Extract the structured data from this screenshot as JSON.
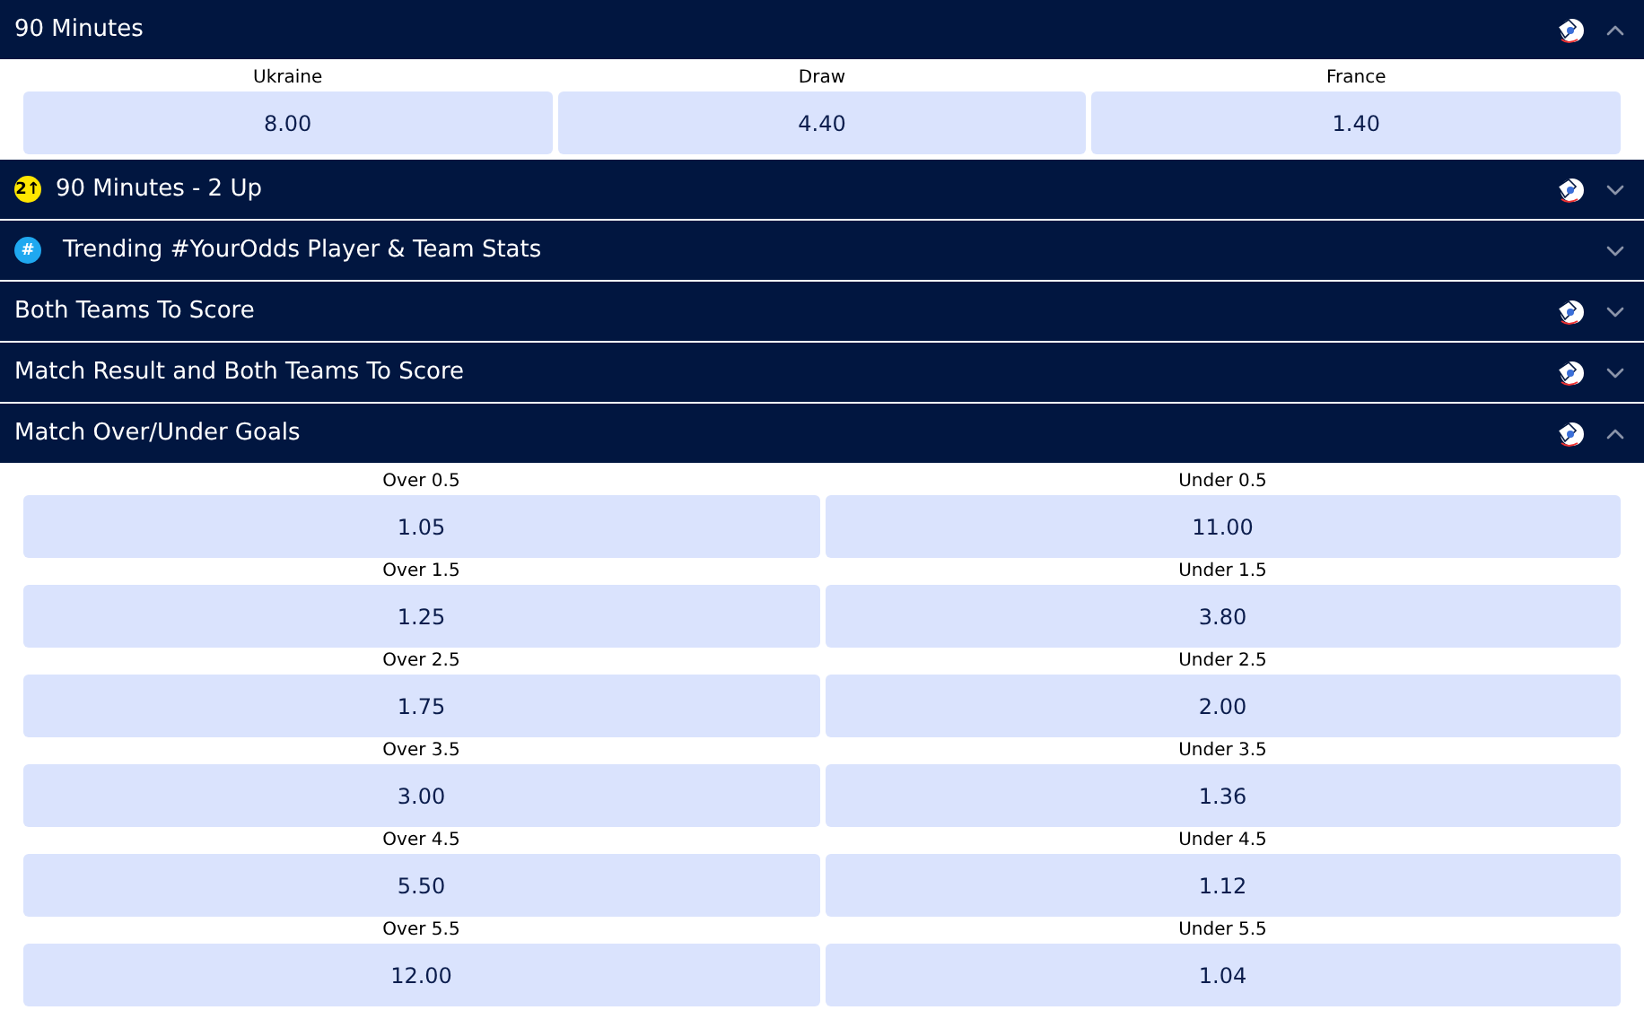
{
  "markets": [
    {
      "title": "90 Minutes",
      "cash_out": true,
      "expanded": true,
      "rows": [
        [
          {
            "label": "Ukraine",
            "odds": "8.00"
          },
          {
            "label": "Draw",
            "odds": "4.40"
          },
          {
            "label": "France",
            "odds": "1.40"
          }
        ]
      ]
    },
    {
      "title": "90 Minutes - 2 Up",
      "badge": {
        "kind": "two-up",
        "text": "2↑"
      },
      "cash_out": true,
      "expanded": false
    },
    {
      "title": "Trending #YourOdds Player & Team Stats",
      "badge": {
        "kind": "hash",
        "text": "#"
      },
      "cash_out": false,
      "expanded": false
    },
    {
      "title": "Both Teams To Score",
      "cash_out": true,
      "expanded": false
    },
    {
      "title": "Match Result and Both Teams To Score",
      "cash_out": true,
      "expanded": false
    },
    {
      "title": "Match Over/Under Goals",
      "cash_out": true,
      "expanded": true,
      "rows": [
        [
          {
            "label": "Over 0.5",
            "odds": "1.05"
          },
          {
            "label": "Under 0.5",
            "odds": "11.00"
          }
        ],
        [
          {
            "label": "Over 1.5",
            "odds": "1.25"
          },
          {
            "label": "Under 1.5",
            "odds": "3.80"
          }
        ],
        [
          {
            "label": "Over 2.5",
            "odds": "1.75"
          },
          {
            "label": "Under 2.5",
            "odds": "2.00"
          }
        ],
        [
          {
            "label": "Over 3.5",
            "odds": "3.00"
          },
          {
            "label": "Under 3.5",
            "odds": "1.36"
          }
        ],
        [
          {
            "label": "Over 4.5",
            "odds": "5.50"
          },
          {
            "label": "Under 4.5",
            "odds": "1.12"
          }
        ],
        [
          {
            "label": "Over 5.5",
            "odds": "12.00"
          },
          {
            "label": "Under 5.5",
            "odds": "1.04"
          }
        ]
      ]
    }
  ]
}
